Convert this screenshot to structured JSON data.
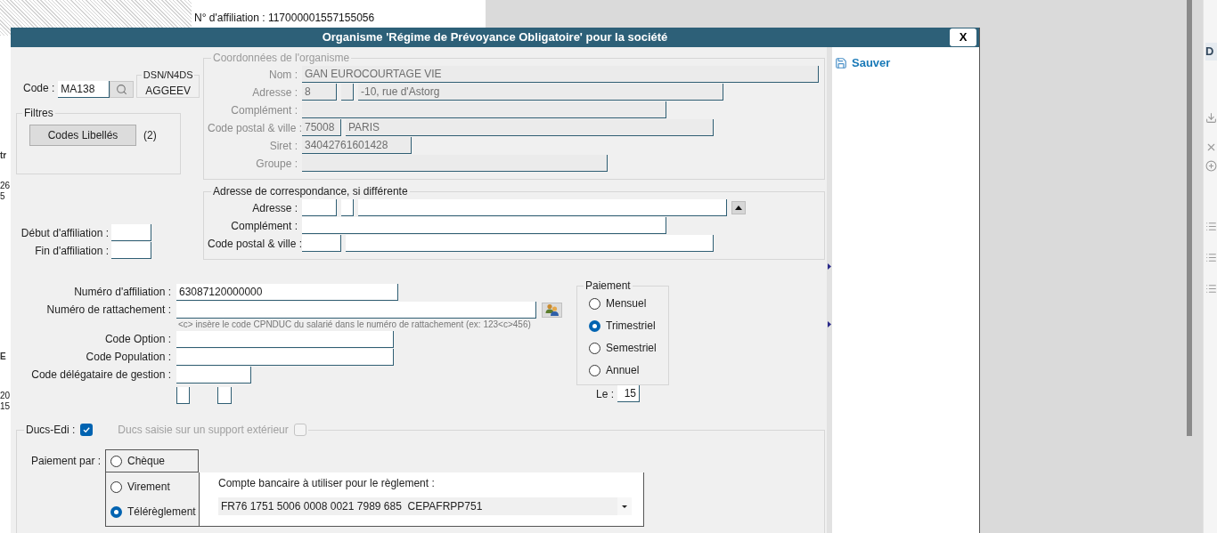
{
  "background": {
    "header_text": "N° d'affiliation : 117000001557155056",
    "edge_fragments": [
      {
        "text": "tr",
        "bold": true
      },
      {
        "text": "26",
        "bold": false
      },
      {
        "text": "5",
        "bold": false
      },
      {
        "text": "E",
        "bold": true
      },
      {
        "text": "20",
        "bold": false
      },
      {
        "text": "15",
        "bold": false
      }
    ],
    "side_tab": "D"
  },
  "dialog": {
    "title": "Organisme 'Régime de Prévoyance Obligatoire' pour la société",
    "close": "X",
    "save": "Sauver"
  },
  "code": {
    "label": "Code :",
    "value": "MA138"
  },
  "dsn": {
    "legend": "DSN/N4DS",
    "value": "AGGEEV"
  },
  "filters": {
    "legend": "Filtres",
    "button": "Codes Libellés",
    "count": "(2)"
  },
  "organisme": {
    "legend": "Coordonnées de l'organisme",
    "disabled": true,
    "rows": [
      {
        "label": "Nom :",
        "fields": [
          {
            "value": "GAN EUROCOURTAGE VIE",
            "disabled": true
          }
        ]
      },
      {
        "label": "Adresse :",
        "fields": [
          {
            "value": "8",
            "disabled": true
          },
          {
            "disabled": true
          },
          {
            "value": "-10, rue d'Astorg",
            "disabled": true
          }
        ]
      },
      {
        "label": "Complément :",
        "fields": [
          {
            "disabled": true
          }
        ]
      },
      {
        "label": "Code postal & ville :",
        "fields": [
          {
            "value": "75008",
            "disabled": true
          },
          {
            "value": "PARIS",
            "disabled": true
          }
        ]
      },
      {
        "label": "Siret :",
        "fields": [
          {
            "value": "34042761601428",
            "disabled": true
          }
        ]
      },
      {
        "label": "Groupe :",
        "fields": [
          {
            "disabled": true
          }
        ]
      }
    ]
  },
  "correspondance": {
    "legend": "Adresse de correspondance, si différente",
    "disabled": false,
    "rows": [
      {
        "label": "Adresse :",
        "fields": [
          {
            "disabled": false
          },
          {
            "disabled": false
          },
          {
            "disabled": false
          }
        ]
      },
      {
        "label": "Complément :",
        "fields": [
          {
            "disabled": false
          }
        ]
      },
      {
        "label": "Code postal & ville :",
        "fields": [
          {
            "disabled": false
          },
          {
            "disabled": false
          }
        ]
      }
    ]
  },
  "dates": [
    {
      "label": "Début d'affiliation :"
    },
    {
      "label": "Fin d'affiliation :"
    }
  ],
  "affiliation": {
    "rows": [
      {
        "label": "Numéro d'affiliation :",
        "value": "63087120000000"
      },
      {
        "label": "Numéro de rattachement :"
      },
      {
        "label": "Code Option :"
      },
      {
        "label": "Code Population :"
      },
      {
        "label": "Code délégataire de gestion :"
      }
    ],
    "hint": "<c> insère le code CPNDUC du salarié dans le numéro de rattachement (ex: 123<c>456)"
  },
  "frequency": {
    "legend": "Paiement",
    "options": [
      {
        "label": "Mensuel",
        "selected": false
      },
      {
        "label": "Trimestriel",
        "selected": true
      },
      {
        "label": "Semestriel",
        "selected": false
      },
      {
        "label": "Annuel",
        "selected": false
      }
    ],
    "day_label": "Le :",
    "day_value": "15"
  },
  "ducs": {
    "label": "Ducs-Edi :",
    "checked": true,
    "external": {
      "label": "Ducs saisie sur un support extérieur",
      "checked": false,
      "disabled": true
    }
  },
  "payment_method": {
    "label": "Paiement par :",
    "options": [
      {
        "label": "Chèque",
        "selected": false
      },
      {
        "label": "Virement",
        "selected": false
      },
      {
        "label": "Télérèglement",
        "selected": true
      }
    ]
  },
  "bank_account": {
    "label": "Compte bancaire à utiliser pour le règlement :",
    "value": "FR76 1751 5006 0008 0021 7989 685  CEPAFRPP751"
  }
}
